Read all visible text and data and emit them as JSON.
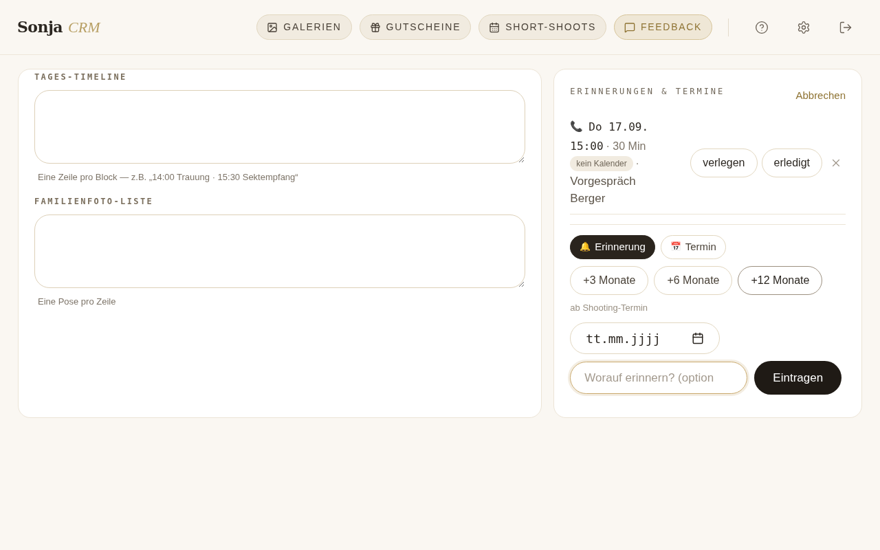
{
  "header": {
    "logo": {
      "name": "Sonja",
      "suffix": "CRM"
    },
    "nav": [
      {
        "kind": "gallery",
        "label": "GALERIEN",
        "highlight": false
      },
      {
        "kind": "gift",
        "label": "GUTSCHEINE",
        "highlight": false
      },
      {
        "kind": "calendar",
        "label": "SHORT-SHOOTS",
        "highlight": false
      },
      {
        "kind": "chat",
        "label": "FEEDBACK",
        "highlight": true
      }
    ],
    "icons": [
      {
        "kind": "help"
      },
      {
        "kind": "settings"
      },
      {
        "kind": "logout"
      }
    ]
  },
  "left_card": {
    "sections": [
      {
        "label": "TAGES-TIMELINE",
        "hint": "Eine Zeile pro Block — z.B. „14:00 Trauung · 15:30 Sektempfang“"
      },
      {
        "label": "FAMILIENFOTO-LISTE",
        "hint": "Eine Pose pro Zeile"
      }
    ]
  },
  "reminders": {
    "title": "ERINNERUNGEN & TERMINE",
    "cancel": "Abbrechen",
    "entries": [
      {
        "icon": "📞",
        "date": "Do 17.09.",
        "time": "15:00",
        "duration": "· 30 Min",
        "badge": "kein Kalender",
        "separator": "·",
        "subject": "Vorgespräch Berger",
        "actions": [
          "verlegen",
          "erledigt"
        ]
      }
    ],
    "types": [
      {
        "icon": "🔔",
        "label": "Erinnerung",
        "selected": true
      },
      {
        "icon": "📅",
        "label": "Termin",
        "selected": false
      }
    ],
    "offsets": [
      {
        "label": "+3 Monate",
        "selected": false
      },
      {
        "label": "+6 Monate",
        "selected": false
      },
      {
        "label": "+12 Monate",
        "selected": true
      }
    ],
    "offset_hint": "ab Shooting-Termin",
    "date_field": {
      "placeholder": "tt.mm.jjjj"
    },
    "note_field": {
      "placeholder": "Worauf erinnern? (option"
    },
    "submit": "Eintragen"
  }
}
